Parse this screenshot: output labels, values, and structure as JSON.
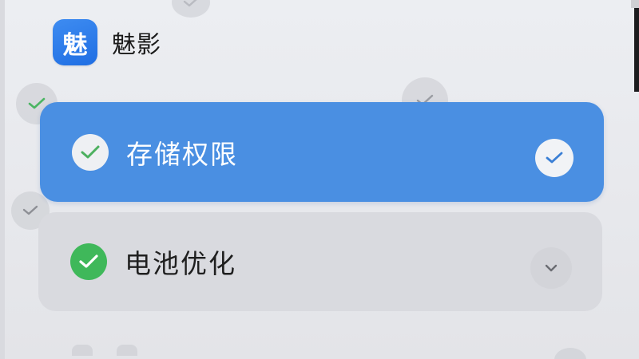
{
  "app": {
    "icon_glyph": "魅",
    "name": "魅影",
    "icon_color": "#2b7be9"
  },
  "permissions": [
    {
      "label": "存储权限",
      "state": "selected",
      "status_icon": "check-icon",
      "trailing_icon": "check-circle-icon",
      "background": "#4a8fe2"
    },
    {
      "label": "电池优化",
      "state": "enabled",
      "status_icon": "check-icon",
      "trailing_icon": "chevron-down-icon",
      "background": "#d9dadf",
      "status_color": "#3fb85a"
    }
  ]
}
